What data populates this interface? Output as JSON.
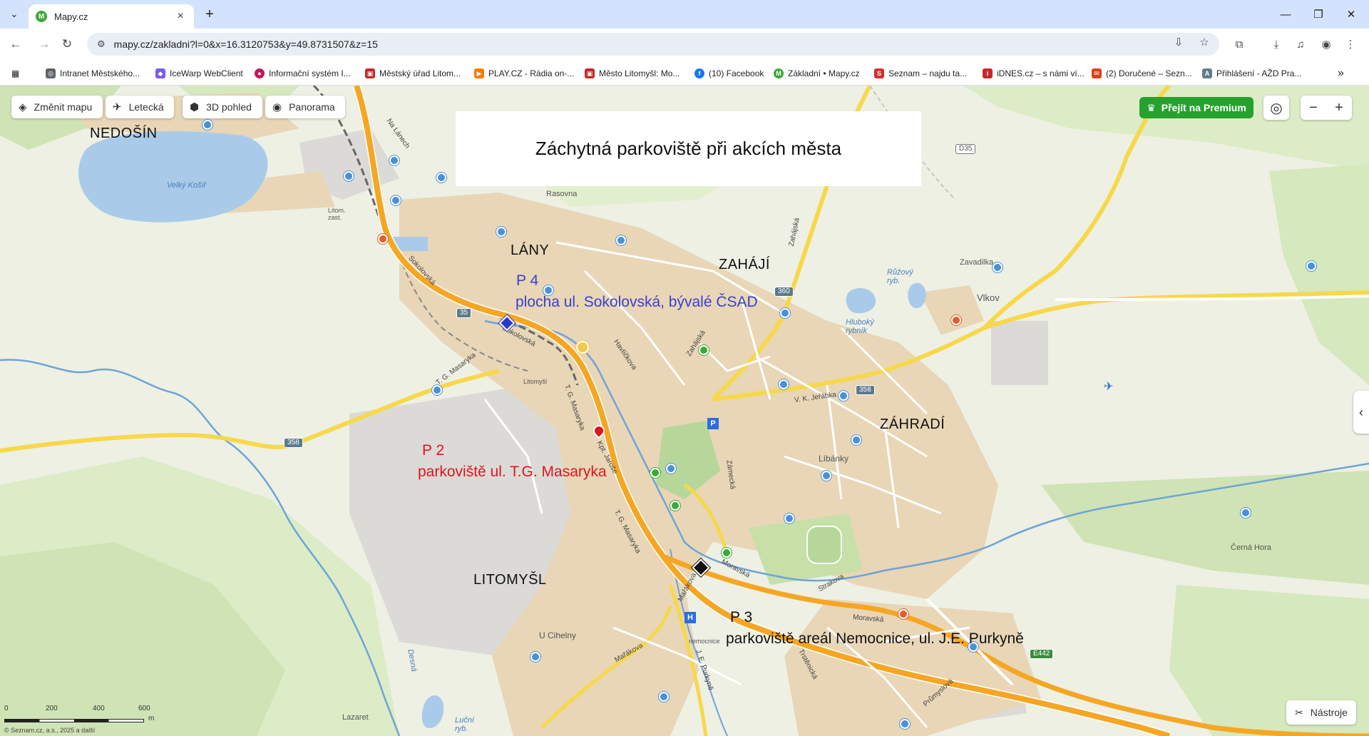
{
  "browser": {
    "tab_title": "Mapy.cz",
    "tab_favicon": "M",
    "url": "mapy.cz/zakladni?l=0&x=16.3120753&y=49.8731507&z=15",
    "bookmarks": [
      {
        "label": "Intranet Městského...",
        "icon": "globe-icon",
        "color": "#5f6368"
      },
      {
        "label": "IceWarp WebClient",
        "icon": "icewarp-icon",
        "color": "#7b5ce6"
      },
      {
        "label": "Informační systém I...",
        "icon": "info-system-icon",
        "color": "#c2185b"
      },
      {
        "label": "Městský úřad Litom...",
        "icon": "city-hall-icon",
        "color": "#c62828"
      },
      {
        "label": "PLAY.CZ - Rádia on-...",
        "icon": "play-icon",
        "color": "#f57c00"
      },
      {
        "label": "Město Litomyšl: Mo...",
        "icon": "city-icon",
        "color": "#c62828"
      },
      {
        "label": "(10) Facebook",
        "icon": "facebook-icon",
        "color": "#1877f2"
      },
      {
        "label": "Základní • Mapy.cz",
        "icon": "mapy-icon",
        "color": "#3aa935"
      },
      {
        "label": "Seznam – najdu ta...",
        "icon": "seznam-icon",
        "color": "#d32f2f"
      },
      {
        "label": "iDNES.cz – s námi ví...",
        "icon": "idnes-icon",
        "color": "#c62828"
      },
      {
        "label": "(2) Doručené – Sezn...",
        "icon": "seznam-mail-icon",
        "color": "#d84315"
      },
      {
        "label": "Přihlášení - AŽD Pra...",
        "icon": "azd-icon",
        "color": "#607d8b"
      }
    ]
  },
  "map_ui": {
    "change_map": "Změnit mapu",
    "aerial": "Letecká",
    "view3d": "3D pohled",
    "panorama": "Panorama",
    "premium": "Přejít na Premium",
    "tools": "Nástroje",
    "title": "Záchytná parkoviště při akcích města",
    "scale_labels": [
      "0",
      "200",
      "400",
      "600",
      "m"
    ],
    "copyright": "© Seznam.cz, a.s., 2025 a další"
  },
  "places": {
    "nedosin": "NEDOŠÍN",
    "lany": "LÁNY",
    "zahaji": "ZAHÁJÍ",
    "zahradi": "ZÁHRADÍ",
    "litomysl": "LITOMYŠL",
    "zavadilka": "Zavadilka",
    "vlkov": "Vlkov",
    "rasovna": "Rasovna",
    "libanky": "Líbánky",
    "cerna_hora": "Černá Hora",
    "u_cihelny": "U Cihelny",
    "lazaret": "Lazaret",
    "litomysl_small": "Litomyšl",
    "litom_zast": "Litom. zast.",
    "nemocnice": "nemocnice"
  },
  "water": {
    "velky_kosir": "Velký Košíř",
    "ruzovy": "Růžový ryb.",
    "hluboky": "Hluboký rybník",
    "lucni": "Luční ryb.",
    "desna": "Desná"
  },
  "streets": {
    "na_lanech": "Na Lánech",
    "sokolovska1": "Sokolovská",
    "sokolovska2": "Sokolovská",
    "tg_masaryka1": "T. G. Masaryka",
    "tg_masaryka2": "T. G. Masaryka",
    "tg_masaryka3": "T. G. Masaryka",
    "havlickova": "Havlíčkova",
    "zahajska1": "Zahájská",
    "zahajska2": "Zahájská",
    "vk_jerabka": "V. K. Jeřábka",
    "kpt_jarose": "Kpt. Jaroše",
    "zamecka": "Zámecká",
    "moravska1": "Moravská",
    "moravska2": "Moravská",
    "strakova": "Strakova",
    "mariakova1": "Mařákova",
    "mariakova2": "Mařákova",
    "je_purkyne": "J. E. Purkyně",
    "trstenicka": "Trstěnická",
    "prumyslova": "Průmyslová"
  },
  "shields": {
    "r35": "35",
    "r358a": "358",
    "r358b": "358",
    "r360": "360",
    "d35": "D35",
    "e442": "E442"
  },
  "annotations": {
    "p4_code": "P 4",
    "p4_text": "plocha ul. Sokolovská, bývalé ČSAD",
    "p2_code": "P 2",
    "p2_text": "parkoviště ul. T.G. Masaryka",
    "p3_code": "P 3",
    "p3_text": "parkoviště areál Nemocnice, ul. J.E. Purkyně"
  },
  "colors": {
    "road_main": "#f5a623",
    "road_secondary": "#f7d84a",
    "urban": "#e8d6b6",
    "water": "#a9cbe9",
    "forest": "#cfe3b4",
    "annotation_blue": "#3a3fcf",
    "annotation_red": "#e0141c",
    "premium_green": "#27a12d"
  }
}
